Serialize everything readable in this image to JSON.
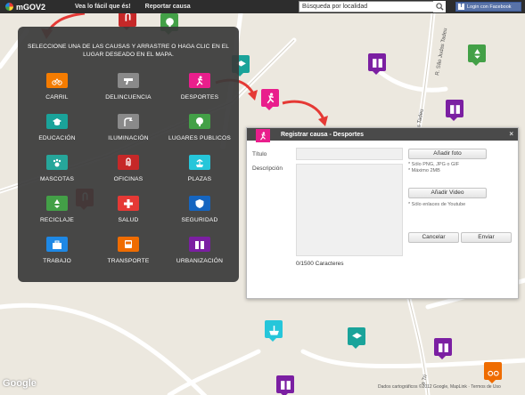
{
  "app": {
    "title": "mGOV2",
    "nav": [
      "Vea lo fácil que és!",
      "Reportar causa"
    ],
    "search_value": "Búsqueda por localidad",
    "facebook_label": "Login con Facebook"
  },
  "panel": {
    "instructions_line1": "SELECCIONE UNA DE LAS CAUSAS Y ARRASTRE O HAGA CLIC EN EL",
    "instructions_line2": "LUGAR DESEADO EN EL MAPA.",
    "categories": [
      {
        "label": "CARRIL",
        "icon": "bicycle-icon",
        "color": "#f57c00"
      },
      {
        "label": "DELINCUENCIA",
        "icon": "gun-icon",
        "color": "#8a8a8a"
      },
      {
        "label": "DESPORTES",
        "icon": "runner-icon",
        "color": "#e91e8c"
      },
      {
        "label": "EDUCACIÓN",
        "icon": "graduation-cap-icon",
        "color": "#1aa39a"
      },
      {
        "label": "ILUMINACIÓN",
        "icon": "lamp-icon",
        "color": "#8a8a8a"
      },
      {
        "label": "LUGARES PUBLICOS",
        "icon": "tree-icon",
        "color": "#43a047"
      },
      {
        "label": "MASCOTAS",
        "icon": "paw-icon",
        "color": "#26a69a"
      },
      {
        "label": "OFICINAS",
        "icon": "paperclip-icon",
        "color": "#c62828"
      },
      {
        "label": "PLAZAS",
        "icon": "fountain-icon",
        "color": "#26c6da"
      },
      {
        "label": "RECICLAJE",
        "icon": "recycle-icon",
        "color": "#43a047"
      },
      {
        "label": "SALUD",
        "icon": "cross-icon",
        "color": "#e53935"
      },
      {
        "label": "SEGURIDAD",
        "icon": "shield-icon",
        "color": "#1565c0"
      },
      {
        "label": "TRABAJO",
        "icon": "briefcase-icon",
        "color": "#1e88e5"
      },
      {
        "label": "TRANSPORTE",
        "icon": "bus-icon",
        "color": "#ef6c00"
      },
      {
        "label": "URBANIZACIÓN",
        "icon": "buildings-icon",
        "color": "#7b1fa2"
      }
    ]
  },
  "dialog": {
    "title": "Registrar causa - Desportes",
    "close": "×",
    "titulo_label": "Título",
    "descripcion_label": "Descripción",
    "add_photo": "Añadir foto",
    "photo_note1": "* Sólo PNG, JPG o GIF",
    "photo_note2": "* Máximo 2MB",
    "add_video": "Añadir Video",
    "video_note": "* Sólo enlaces de Youtube",
    "cancel": "Cancelar",
    "send": "Enviar",
    "char_count": "0/1500 Caracteres"
  },
  "map": {
    "street_1": "R. São Judas Tadeu",
    "street_2": "das Tadeu",
    "street_3": "a Tri",
    "attribution": "Dados cartográficos ©2012 Google, MapLink · Termos de Uso",
    "google": "Google"
  }
}
